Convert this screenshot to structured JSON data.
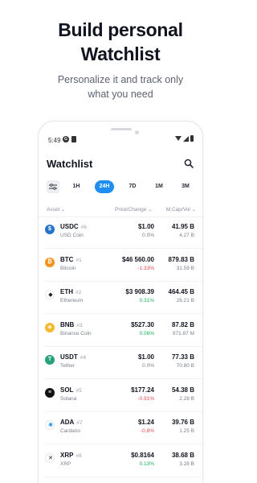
{
  "promo": {
    "title_line1": "Build personal",
    "title_line2": "Watchlist",
    "subtitle_line1": "Personalize it and track only",
    "subtitle_line2": "what you need"
  },
  "status_bar": {
    "time": "5:49",
    "g_icon": "G"
  },
  "header": {
    "title": "Watchlist"
  },
  "tabs": [
    "1H",
    "24H",
    "7D",
    "1M",
    "3M"
  ],
  "active_tab": "24H",
  "columns": {
    "asset": "Asset ⌄",
    "price_change": "Price/Change ⌄",
    "mcap_vol": "M.Cap/Vol ⌄"
  },
  "coins": [
    {
      "symbol": "USDC",
      "rank": "#6",
      "name": "USD Coin",
      "price": "$1.00",
      "change": "0.0%",
      "change_dir": "neutral",
      "mcap": "41.95 B",
      "vol": "4.27 B",
      "icon": "usdc-icon",
      "color": "#2775ca",
      "glyph": "$"
    },
    {
      "symbol": "BTC",
      "rank": "#1",
      "name": "Bitcoin",
      "price": "$46 560.00",
      "change": "-1.33%",
      "change_dir": "down",
      "mcap": "879.83 B",
      "vol": "31.59 B",
      "icon": "btc-icon",
      "color": "#f7931a",
      "glyph": "₿"
    },
    {
      "symbol": "ETH",
      "rank": "#2",
      "name": "Ethereum",
      "price": "$3 908.39",
      "change": "0.31%",
      "change_dir": "up",
      "mcap": "464.45 B",
      "vol": "26.21 B",
      "icon": "eth-icon",
      "color": "#ffffff",
      "glyph": "◆"
    },
    {
      "symbol": "BNB",
      "rank": "#3",
      "name": "Binance Coin",
      "price": "$527.30",
      "change": "0.06%",
      "change_dir": "up",
      "mcap": "87.82 B",
      "vol": "971.87 M",
      "icon": "bnb-icon",
      "color": "#f3ba2f",
      "glyph": "◈"
    },
    {
      "symbol": "USDT",
      "rank": "#4",
      "name": "Tether",
      "price": "$1.00",
      "change": "0.0%",
      "change_dir": "neutral",
      "mcap": "77.33 B",
      "vol": "70.80 B",
      "icon": "usdt-icon",
      "color": "#26a17b",
      "glyph": "T"
    },
    {
      "symbol": "SOL",
      "rank": "#5",
      "name": "Solana",
      "price": "$177.24",
      "change": "-0.91%",
      "change_dir": "down",
      "mcap": "54.38 B",
      "vol": "2.28 B",
      "icon": "sol-icon",
      "color": "#111111",
      "glyph": "≡"
    },
    {
      "symbol": "ADA",
      "rank": "#7",
      "name": "Cardano",
      "price": "$1.24",
      "change": "-0.8%",
      "change_dir": "down",
      "mcap": "39.76 B",
      "vol": "1.25 B",
      "icon": "ada-icon",
      "color": "#ffffff",
      "glyph": "✺"
    },
    {
      "symbol": "XRP",
      "rank": "#8",
      "name": "XRP",
      "price": "$0.8164",
      "change": "0.13%",
      "change_dir": "up",
      "mcap": "38.68 B",
      "vol": "3.28 B",
      "icon": "xrp-icon",
      "color": "#ffffff",
      "glyph": "✕"
    }
  ],
  "colors": {
    "accent": "#1f8ef1",
    "down": "#e5484d",
    "up": "#19b35c",
    "neutral": "#7a7f8b"
  }
}
